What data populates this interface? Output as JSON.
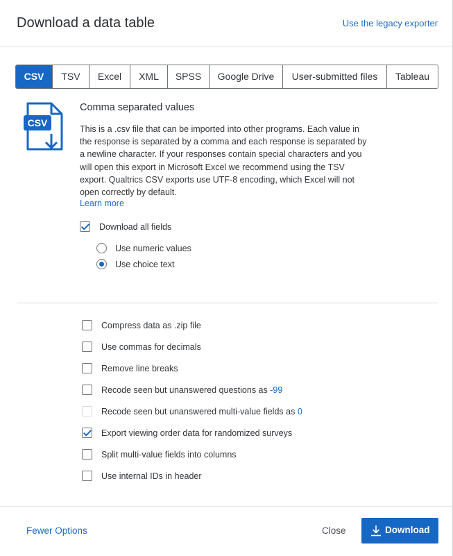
{
  "header": {
    "title": "Download a data table",
    "legacy_link": "Use the legacy exporter"
  },
  "tabs": [
    {
      "label": "CSV",
      "active": true
    },
    {
      "label": "TSV",
      "active": false
    },
    {
      "label": "Excel",
      "active": false
    },
    {
      "label": "XML",
      "active": false
    },
    {
      "label": "SPSS",
      "active": false
    },
    {
      "label": "Google Drive",
      "active": false
    },
    {
      "label": "User-submitted files",
      "active": false
    },
    {
      "label": "Tableau",
      "active": false
    }
  ],
  "format": {
    "icon_text": "CSV",
    "title": "Comma separated values",
    "description": "This is a .csv file that can be imported into other programs. Each value in the response is separated by a comma and each response is separated by a newline character. If your responses contain special characters and you will open this export in Microsoft Excel we recommend using the TSV export. Qualtrics CSV exports use UTF-8 encoding, which Excel will not open correctly by default.",
    "learn_more": "Learn more"
  },
  "download_all_fields": {
    "label": "Download all fields",
    "checked": true
  },
  "value_options": [
    {
      "label": "Use numeric values",
      "selected": false
    },
    {
      "label": "Use choice text",
      "selected": true
    }
  ],
  "options": {
    "compress": {
      "label": "Compress data as .zip file",
      "checked": false
    },
    "commas": {
      "label": "Use commas for decimals",
      "checked": false
    },
    "line_breaks": {
      "label": "Remove line breaks",
      "checked": false
    },
    "recode_questions": {
      "label": "Recode seen but unanswered questions as",
      "value": "-99",
      "checked": false
    },
    "recode_multi": {
      "label": "Recode seen but unanswered multi-value fields as",
      "value": "0",
      "checked": false,
      "disabled": true
    },
    "viewing_order": {
      "label": "Export viewing order data for randomized surveys",
      "checked": true
    },
    "split_multi": {
      "label": "Split multi-value fields into columns",
      "checked": false
    },
    "internal_ids": {
      "label": "Use internal IDs in header",
      "checked": false
    }
  },
  "footer": {
    "fewer_options": "Fewer Options",
    "close": "Close",
    "download": "Download"
  },
  "colors": {
    "accent": "#1768c4",
    "link": "#1c6bc4",
    "text": "#32363a"
  }
}
